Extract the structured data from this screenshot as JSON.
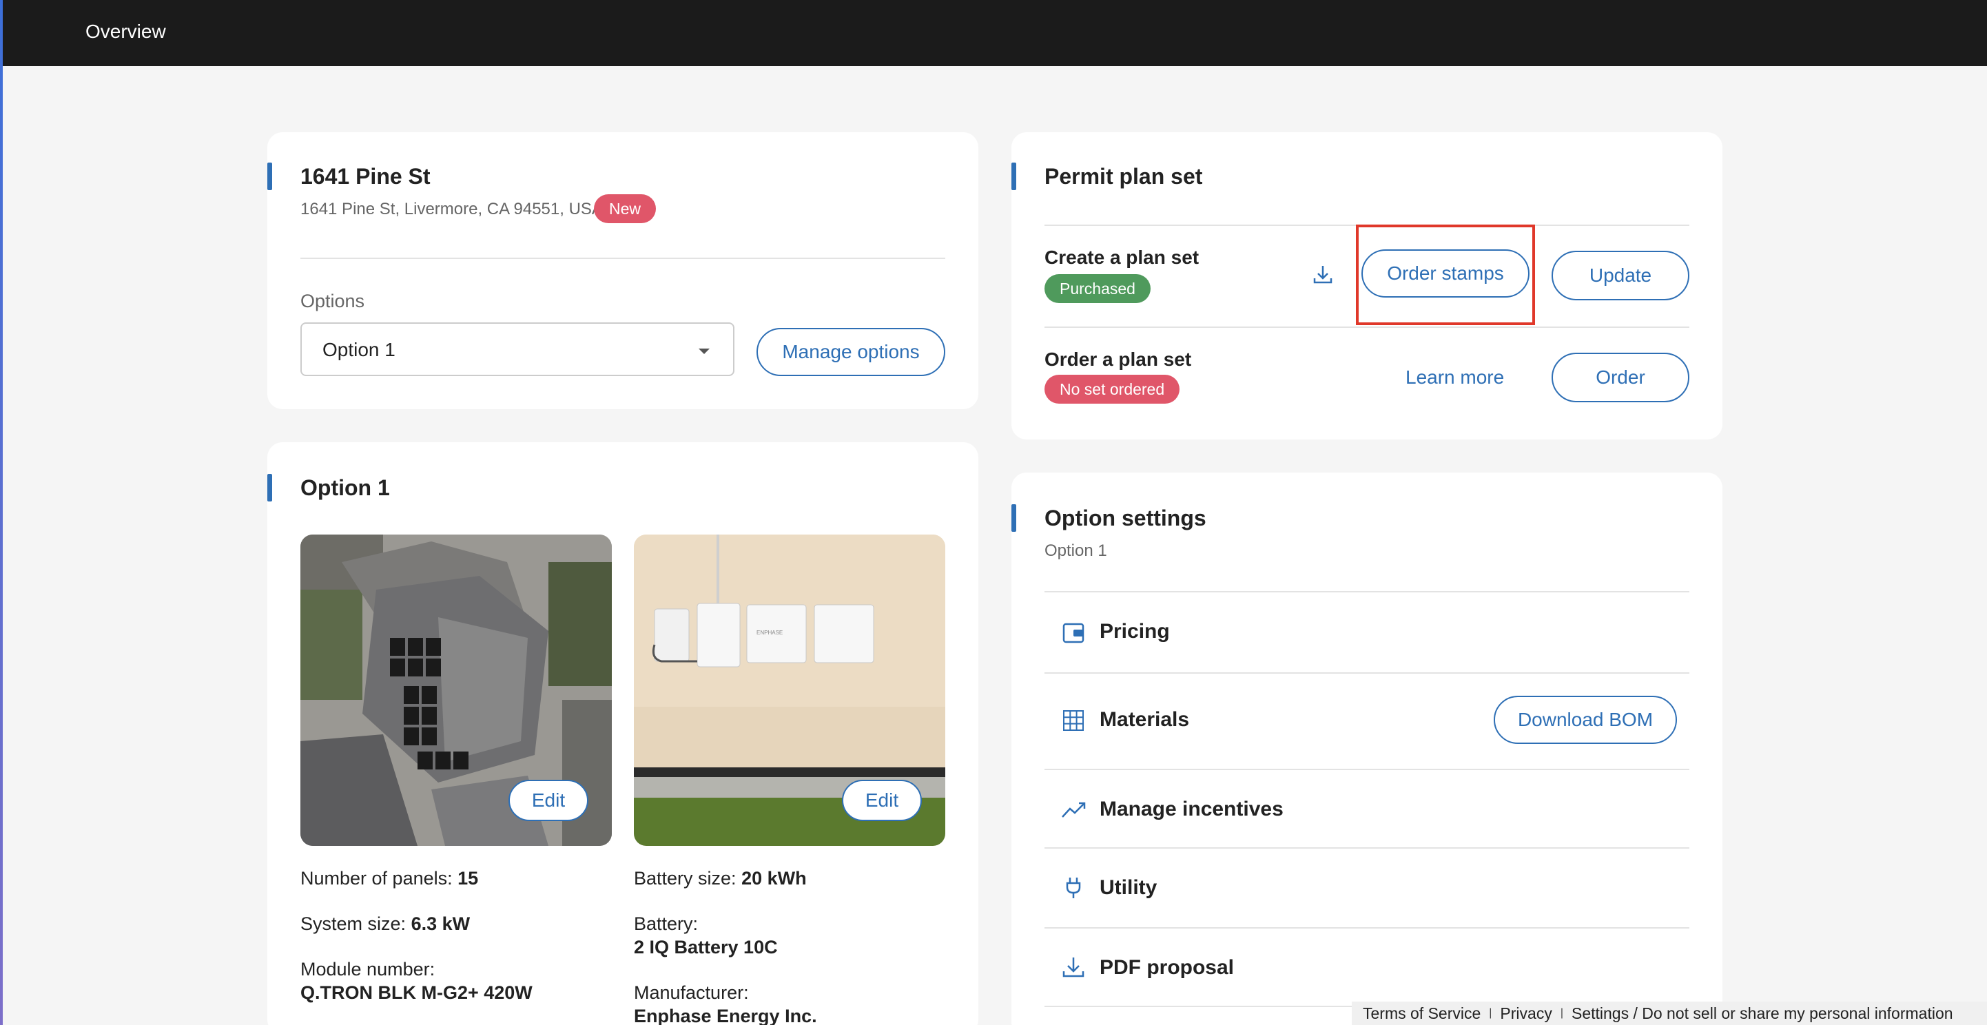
{
  "topbar": {
    "title": "Overview"
  },
  "address_card": {
    "title": "1641 Pine St",
    "address": "1641 Pine St, Livermore, CA 94551, USA",
    "badge": "New",
    "options_label": "Options",
    "selected_option": "Option 1",
    "manage_button": "Manage options"
  },
  "option_card": {
    "title": "Option 1",
    "edit_label": "Edit",
    "solar": {
      "panels_label": "Number of panels:",
      "panels_value": "15",
      "system_label": "System size:",
      "system_value": "6.3 kW",
      "module_label": "Module number:",
      "module_value": "Q.TRON BLK M-G2+ 420W"
    },
    "battery": {
      "size_label": "Battery size:",
      "size_value": "20 kWh",
      "battery_label": "Battery:",
      "battery_value": "2 IQ Battery 10C",
      "manufacturer_label": "Manufacturer:",
      "manufacturer_value": "Enphase Energy Inc.",
      "brand_text": "ENPHASE"
    }
  },
  "permit_card": {
    "title": "Permit plan set",
    "create": {
      "label": "Create a plan set",
      "badge": "Purchased",
      "order_stamps": "Order stamps",
      "update": "Update"
    },
    "order": {
      "label": "Order a plan set",
      "badge": "No set ordered",
      "learn_more": "Learn more",
      "order": "Order"
    }
  },
  "settings_card": {
    "title": "Option settings",
    "subtitle": "Option 1",
    "rows": [
      {
        "label": "Pricing",
        "icon": "wallet-icon"
      },
      {
        "label": "Materials",
        "icon": "grid-icon",
        "button": "Download BOM"
      },
      {
        "label": "Manage incentives",
        "icon": "trend-up-icon"
      },
      {
        "label": "Utility",
        "icon": "plug-icon"
      },
      {
        "label": "PDF proposal",
        "icon": "download-icon"
      }
    ]
  },
  "footer": {
    "terms": "Terms of Service",
    "privacy": "Privacy",
    "settings": "Settings / Do not sell or share my personal information",
    "separator": "|"
  },
  "colors": {
    "accent": "#2e6fb5",
    "badge_red": "#e05669",
    "badge_green": "#4f9a5c",
    "highlight": "#e0382a",
    "topbar": "#1b1b1b"
  }
}
